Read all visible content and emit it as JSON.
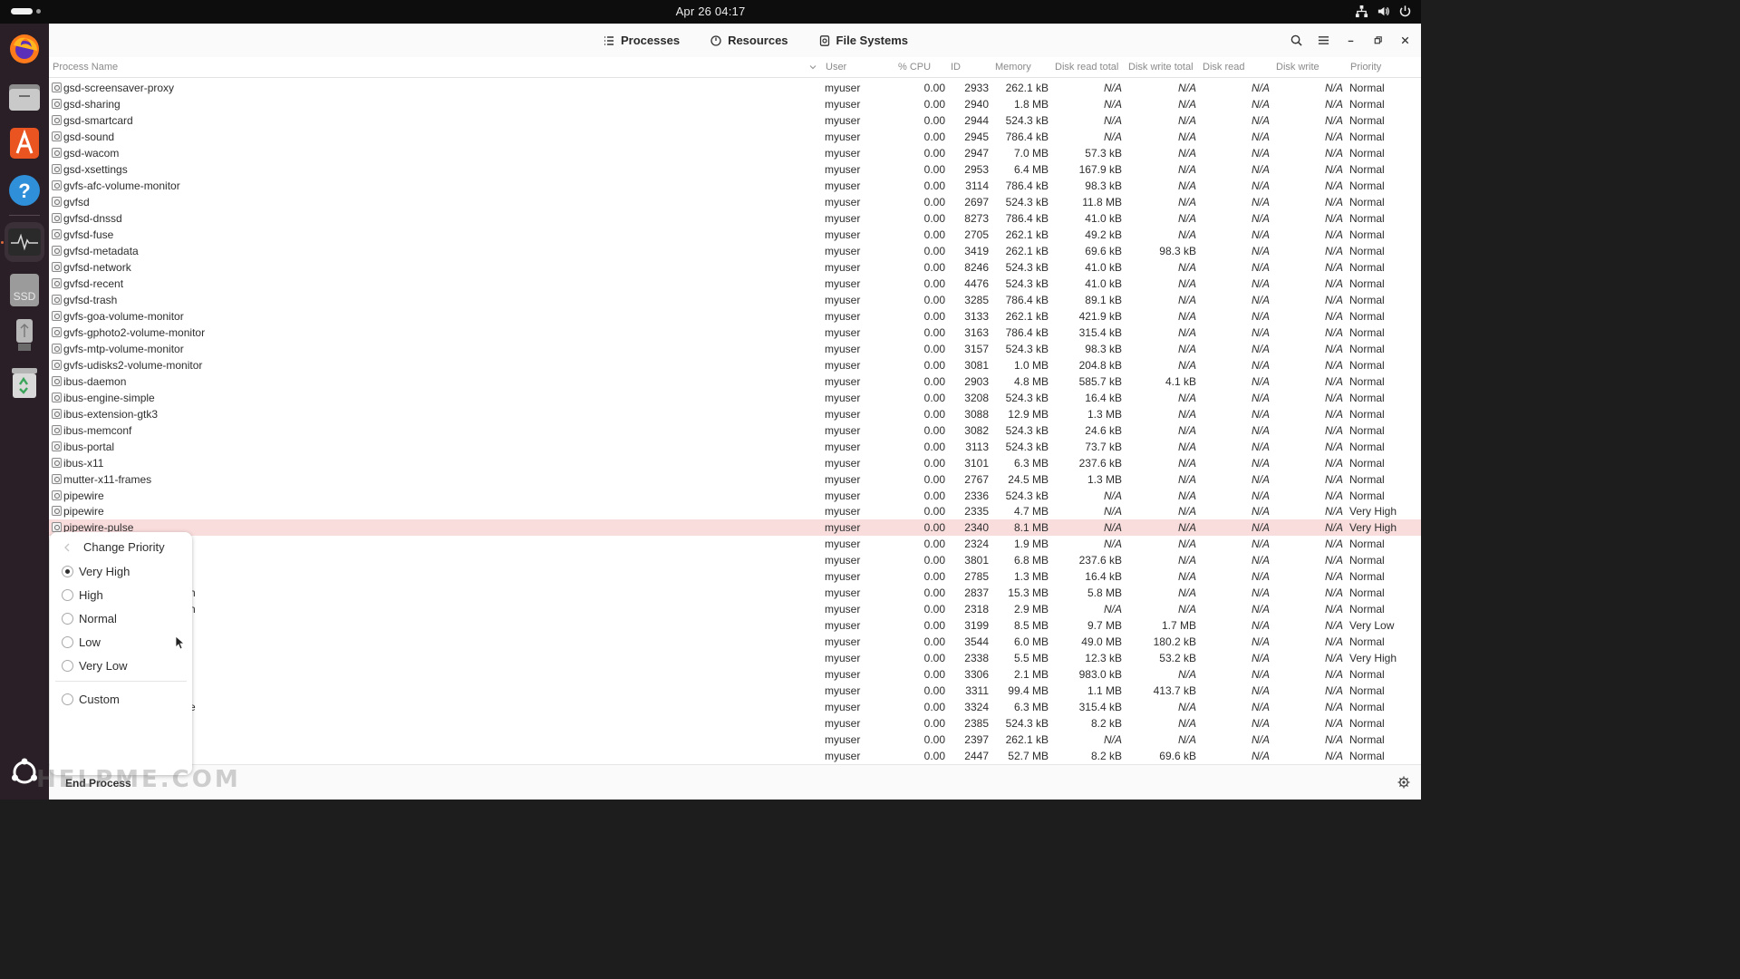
{
  "topbar": {
    "clock": "Apr 26  04:17"
  },
  "dock": {
    "items": [
      "firefox-icon",
      "files-icon",
      "app-center-icon",
      "help-icon",
      "system-monitor-icon",
      "ssd-drive-icon",
      "usb-drive-icon",
      "trash-icon",
      "show-apps-icon"
    ],
    "ssd_label": "SSD"
  },
  "tabs": [
    {
      "label": "Processes"
    },
    {
      "label": "Resources"
    },
    {
      "label": "File Systems"
    }
  ],
  "columns": {
    "name": "Process Name",
    "user": "User",
    "cpu": "% CPU",
    "id": "ID",
    "memory": "Memory",
    "disk_read_total": "Disk read total",
    "disk_write_total": "Disk write total",
    "disk_read": "Disk read",
    "disk_write": "Disk write",
    "priority": "Priority"
  },
  "rows": [
    {
      "name": "gsd-screensaver-proxy",
      "user": "myuser",
      "cpu": "0.00",
      "id": "2933",
      "mem": "262.1 kB",
      "drt": "N/A",
      "dwt": "N/A",
      "dr": "N/A",
      "dw": "N/A",
      "pri": "Normal"
    },
    {
      "name": "gsd-sharing",
      "user": "myuser",
      "cpu": "0.00",
      "id": "2940",
      "mem": "1.8 MB",
      "drt": "N/A",
      "dwt": "N/A",
      "dr": "N/A",
      "dw": "N/A",
      "pri": "Normal"
    },
    {
      "name": "gsd-smartcard",
      "user": "myuser",
      "cpu": "0.00",
      "id": "2944",
      "mem": "524.3 kB",
      "drt": "N/A",
      "dwt": "N/A",
      "dr": "N/A",
      "dw": "N/A",
      "pri": "Normal"
    },
    {
      "name": "gsd-sound",
      "user": "myuser",
      "cpu": "0.00",
      "id": "2945",
      "mem": "786.4 kB",
      "drt": "N/A",
      "dwt": "N/A",
      "dr": "N/A",
      "dw": "N/A",
      "pri": "Normal"
    },
    {
      "name": "gsd-wacom",
      "user": "myuser",
      "cpu": "0.00",
      "id": "2947",
      "mem": "7.0 MB",
      "drt": "57.3 kB",
      "dwt": "N/A",
      "dr": "N/A",
      "dw": "N/A",
      "pri": "Normal"
    },
    {
      "name": "gsd-xsettings",
      "user": "myuser",
      "cpu": "0.00",
      "id": "2953",
      "mem": "6.4 MB",
      "drt": "167.9 kB",
      "dwt": "N/A",
      "dr": "N/A",
      "dw": "N/A",
      "pri": "Normal"
    },
    {
      "name": "gvfs-afc-volume-monitor",
      "user": "myuser",
      "cpu": "0.00",
      "id": "3114",
      "mem": "786.4 kB",
      "drt": "98.3 kB",
      "dwt": "N/A",
      "dr": "N/A",
      "dw": "N/A",
      "pri": "Normal"
    },
    {
      "name": "gvfsd",
      "user": "myuser",
      "cpu": "0.00",
      "id": "2697",
      "mem": "524.3 kB",
      "drt": "11.8 MB",
      "dwt": "N/A",
      "dr": "N/A",
      "dw": "N/A",
      "pri": "Normal"
    },
    {
      "name": "gvfsd-dnssd",
      "user": "myuser",
      "cpu": "0.00",
      "id": "8273",
      "mem": "786.4 kB",
      "drt": "41.0 kB",
      "dwt": "N/A",
      "dr": "N/A",
      "dw": "N/A",
      "pri": "Normal"
    },
    {
      "name": "gvfsd-fuse",
      "user": "myuser",
      "cpu": "0.00",
      "id": "2705",
      "mem": "262.1 kB",
      "drt": "49.2 kB",
      "dwt": "N/A",
      "dr": "N/A",
      "dw": "N/A",
      "pri": "Normal"
    },
    {
      "name": "gvfsd-metadata",
      "user": "myuser",
      "cpu": "0.00",
      "id": "3419",
      "mem": "262.1 kB",
      "drt": "69.6 kB",
      "dwt": "98.3 kB",
      "dr": "N/A",
      "dw": "N/A",
      "pri": "Normal"
    },
    {
      "name": "gvfsd-network",
      "user": "myuser",
      "cpu": "0.00",
      "id": "8246",
      "mem": "524.3 kB",
      "drt": "41.0 kB",
      "dwt": "N/A",
      "dr": "N/A",
      "dw": "N/A",
      "pri": "Normal"
    },
    {
      "name": "gvfsd-recent",
      "user": "myuser",
      "cpu": "0.00",
      "id": "4476",
      "mem": "524.3 kB",
      "drt": "41.0 kB",
      "dwt": "N/A",
      "dr": "N/A",
      "dw": "N/A",
      "pri": "Normal"
    },
    {
      "name": "gvfsd-trash",
      "user": "myuser",
      "cpu": "0.00",
      "id": "3285",
      "mem": "786.4 kB",
      "drt": "89.1 kB",
      "dwt": "N/A",
      "dr": "N/A",
      "dw": "N/A",
      "pri": "Normal"
    },
    {
      "name": "gvfs-goa-volume-monitor",
      "user": "myuser",
      "cpu": "0.00",
      "id": "3133",
      "mem": "262.1 kB",
      "drt": "421.9 kB",
      "dwt": "N/A",
      "dr": "N/A",
      "dw": "N/A",
      "pri": "Normal"
    },
    {
      "name": "gvfs-gphoto2-volume-monitor",
      "user": "myuser",
      "cpu": "0.00",
      "id": "3163",
      "mem": "786.4 kB",
      "drt": "315.4 kB",
      "dwt": "N/A",
      "dr": "N/A",
      "dw": "N/A",
      "pri": "Normal"
    },
    {
      "name": "gvfs-mtp-volume-monitor",
      "user": "myuser",
      "cpu": "0.00",
      "id": "3157",
      "mem": "524.3 kB",
      "drt": "98.3 kB",
      "dwt": "N/A",
      "dr": "N/A",
      "dw": "N/A",
      "pri": "Normal"
    },
    {
      "name": "gvfs-udisks2-volume-monitor",
      "user": "myuser",
      "cpu": "0.00",
      "id": "3081",
      "mem": "1.0 MB",
      "drt": "204.8 kB",
      "dwt": "N/A",
      "dr": "N/A",
      "dw": "N/A",
      "pri": "Normal"
    },
    {
      "name": "ibus-daemon",
      "user": "myuser",
      "cpu": "0.00",
      "id": "2903",
      "mem": "4.8 MB",
      "drt": "585.7 kB",
      "dwt": "4.1 kB",
      "dr": "N/A",
      "dw": "N/A",
      "pri": "Normal"
    },
    {
      "name": "ibus-engine-simple",
      "user": "myuser",
      "cpu": "0.00",
      "id": "3208",
      "mem": "524.3 kB",
      "drt": "16.4 kB",
      "dwt": "N/A",
      "dr": "N/A",
      "dw": "N/A",
      "pri": "Normal"
    },
    {
      "name": "ibus-extension-gtk3",
      "user": "myuser",
      "cpu": "0.00",
      "id": "3088",
      "mem": "12.9 MB",
      "drt": "1.3 MB",
      "dwt": "N/A",
      "dr": "N/A",
      "dw": "N/A",
      "pri": "Normal"
    },
    {
      "name": "ibus-memconf",
      "user": "myuser",
      "cpu": "0.00",
      "id": "3082",
      "mem": "524.3 kB",
      "drt": "24.6 kB",
      "dwt": "N/A",
      "dr": "N/A",
      "dw": "N/A",
      "pri": "Normal"
    },
    {
      "name": "ibus-portal",
      "user": "myuser",
      "cpu": "0.00",
      "id": "3113",
      "mem": "524.3 kB",
      "drt": "73.7 kB",
      "dwt": "N/A",
      "dr": "N/A",
      "dw": "N/A",
      "pri": "Normal"
    },
    {
      "name": "ibus-x11",
      "user": "myuser",
      "cpu": "0.00",
      "id": "3101",
      "mem": "6.3 MB",
      "drt": "237.6 kB",
      "dwt": "N/A",
      "dr": "N/A",
      "dw": "N/A",
      "pri": "Normal"
    },
    {
      "name": "mutter-x11-frames",
      "user": "myuser",
      "cpu": "0.00",
      "id": "2767",
      "mem": "24.5 MB",
      "drt": "1.3 MB",
      "dwt": "N/A",
      "dr": "N/A",
      "dw": "N/A",
      "pri": "Normal"
    },
    {
      "name": "pipewire",
      "user": "myuser",
      "cpu": "0.00",
      "id": "2336",
      "mem": "524.3 kB",
      "drt": "N/A",
      "dwt": "N/A",
      "dr": "N/A",
      "dw": "N/A",
      "pri": "Normal"
    },
    {
      "name": "pipewire",
      "user": "myuser",
      "cpu": "0.00",
      "id": "2335",
      "mem": "4.7 MB",
      "drt": "N/A",
      "dwt": "N/A",
      "dr": "N/A",
      "dw": "N/A",
      "pri": "Very High"
    },
    {
      "name": "pipewire-pulse",
      "user": "myuser",
      "cpu": "0.00",
      "id": "2340",
      "mem": "8.1 MB",
      "drt": "N/A",
      "dwt": "N/A",
      "dr": "N/A",
      "dw": "N/A",
      "pri": "Very High",
      "selected": true
    },
    {
      "name": "",
      "user": "myuser",
      "cpu": "0.00",
      "id": "2324",
      "mem": "1.9 MB",
      "drt": "N/A",
      "dwt": "N/A",
      "dr": "N/A",
      "dw": "N/A",
      "pri": "Normal"
    },
    {
      "name": "",
      "user": "myuser",
      "cpu": "0.00",
      "id": "3801",
      "mem": "6.8 MB",
      "drt": "237.6 kB",
      "dwt": "N/A",
      "dr": "N/A",
      "dw": "N/A",
      "pri": "Normal"
    },
    {
      "name": "",
      "user": "myuser",
      "cpu": "0.00",
      "id": "2785",
      "mem": "1.3 MB",
      "drt": "16.4 kB",
      "dwt": "N/A",
      "dr": "N/A",
      "dw": "N/A",
      "pri": "Normal"
    },
    {
      "name": "",
      "user": "myuser",
      "cpu": "0.00",
      "id": "2837",
      "mem": "15.3 MB",
      "drt": "5.8 MB",
      "dwt": "N/A",
      "dr": "N/A",
      "dw": "N/A",
      "pri": "Normal"
    },
    {
      "name": "",
      "user": "myuser",
      "cpu": "0.00",
      "id": "2318",
      "mem": "2.9 MB",
      "drt": "N/A",
      "dwt": "N/A",
      "dr": "N/A",
      "dw": "N/A",
      "pri": "Normal"
    },
    {
      "name": "",
      "user": "myuser",
      "cpu": "0.00",
      "id": "3199",
      "mem": "8.5 MB",
      "drt": "9.7 MB",
      "dwt": "1.7 MB",
      "dr": "N/A",
      "dw": "N/A",
      "pri": "Very Low"
    },
    {
      "name": "",
      "user": "myuser",
      "cpu": "0.00",
      "id": "3544",
      "mem": "6.0 MB",
      "drt": "49.0 MB",
      "dwt": "180.2 kB",
      "dr": "N/A",
      "dw": "N/A",
      "pri": "Normal"
    },
    {
      "name": "",
      "user": "myuser",
      "cpu": "0.00",
      "id": "2338",
      "mem": "5.5 MB",
      "drt": "12.3 kB",
      "dwt": "53.2 kB",
      "dr": "N/A",
      "dw": "N/A",
      "pri": "Very High"
    },
    {
      "name": "",
      "user": "myuser",
      "cpu": "0.00",
      "id": "3306",
      "mem": "2.1 MB",
      "drt": "983.0 kB",
      "dwt": "N/A",
      "dr": "N/A",
      "dw": "N/A",
      "pri": "Normal"
    },
    {
      "name": "",
      "user": "myuser",
      "cpu": "0.00",
      "id": "3311",
      "mem": "99.4 MB",
      "drt": "1.1 MB",
      "dwt": "413.7 kB",
      "dr": "N/A",
      "dw": "N/A",
      "pri": "Normal"
    },
    {
      "name": "",
      "user": "myuser",
      "cpu": "0.00",
      "id": "3324",
      "mem": "6.3 MB",
      "drt": "315.4 kB",
      "dwt": "N/A",
      "dr": "N/A",
      "dw": "N/A",
      "pri": "Normal"
    },
    {
      "name": "",
      "user": "myuser",
      "cpu": "0.00",
      "id": "2385",
      "mem": "524.3 kB",
      "drt": "8.2 kB",
      "dwt": "N/A",
      "dr": "N/A",
      "dw": "N/A",
      "pri": "Normal"
    },
    {
      "name": "",
      "user": "myuser",
      "cpu": "0.00",
      "id": "2397",
      "mem": "262.1 kB",
      "drt": "N/A",
      "dwt": "N/A",
      "dr": "N/A",
      "dw": "N/A",
      "pri": "Normal"
    },
    {
      "name": "",
      "user": "myuser",
      "cpu": "0.00",
      "id": "2447",
      "mem": "52.7 MB",
      "drt": "8.2 kB",
      "dwt": "69.6 kB",
      "dr": "N/A",
      "dw": "N/A",
      "pri": "Normal"
    }
  ],
  "partial_name_fragments": {
    "r31": "n",
    "r32": "n",
    "r38": "e"
  },
  "popover": {
    "title": "Change Priority",
    "options": [
      {
        "label": "Very High",
        "selected": true
      },
      {
        "label": "High",
        "selected": false
      },
      {
        "label": "Normal",
        "selected": false
      },
      {
        "label": "Low",
        "selected": false
      },
      {
        "label": "Very Low",
        "selected": false
      }
    ],
    "custom_label": "Custom"
  },
  "footer": {
    "end_process": "End Process"
  },
  "watermark": "HELPME.COM",
  "colors": {
    "selected_row": "#f9dcdc",
    "dock_bg": "#2a1f27",
    "topbar_bg": "#0d0d0d"
  }
}
